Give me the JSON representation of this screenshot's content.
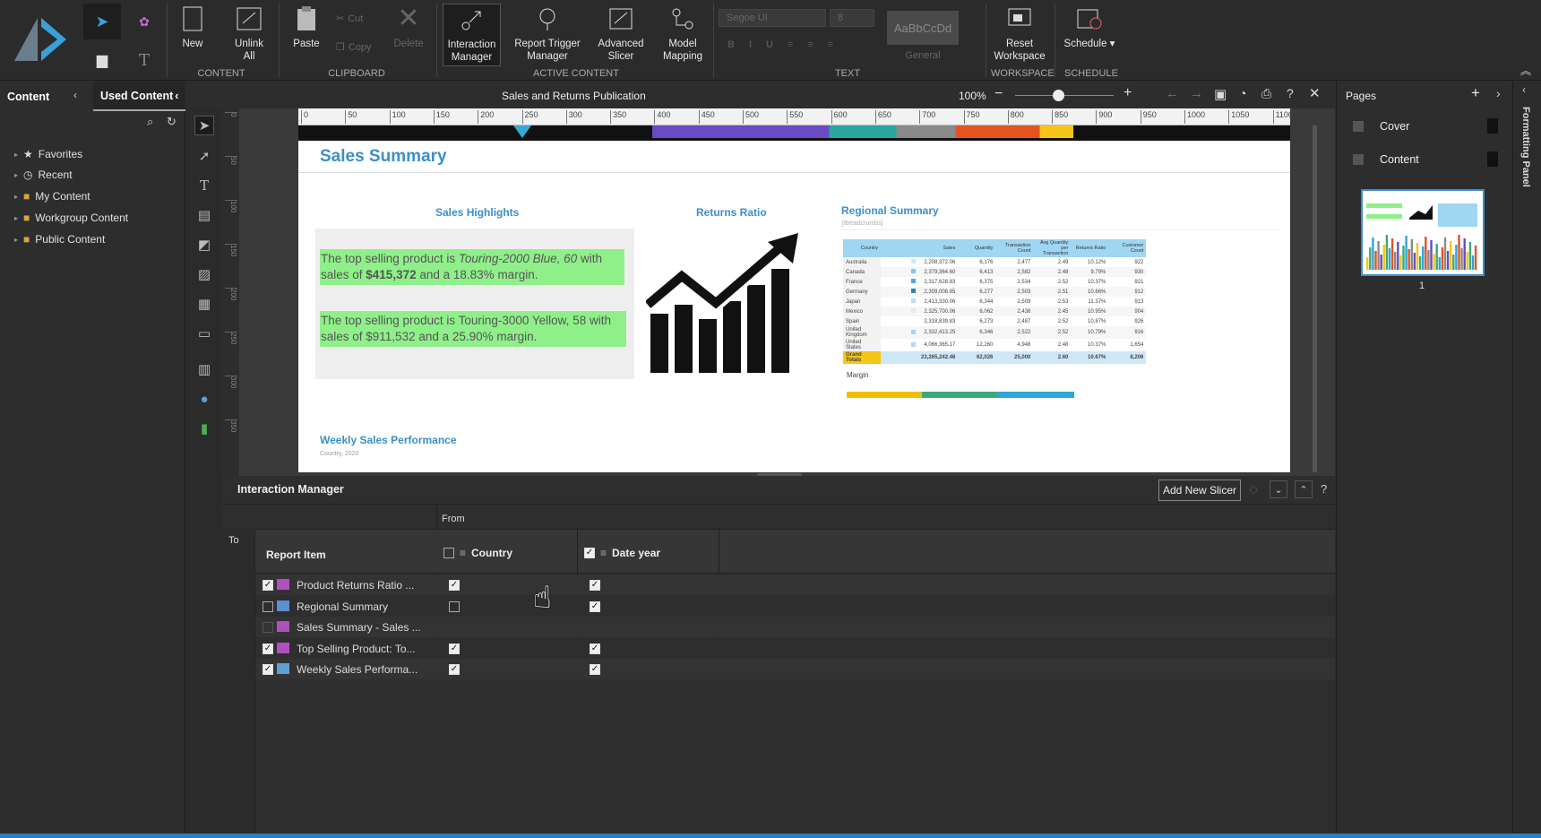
{
  "ribbon": {
    "new": "New",
    "unlink_all_1": "Unlink",
    "unlink_all_2": "All",
    "paste": "Paste",
    "cut": "Cut",
    "copy": "Copy",
    "delete": "Delete",
    "interaction_manager_1": "Interaction",
    "interaction_manager_2": "Manager",
    "report_trigger_1": "Report Trigger",
    "report_trigger_2": "Manager",
    "advanced_slicer_1": "Advanced",
    "advanced_slicer_2": "Slicer",
    "model_mapping_1": "Model",
    "model_mapping_2": "Mapping",
    "font_name": "Segoe UI",
    "font_size": "8",
    "style_preview": "AaBbCcDd",
    "style_name": "General",
    "reset_workspace_1": "Reset",
    "reset_workspace_2": "Workspace",
    "schedule": "Schedule ▾",
    "groups": {
      "content": "CONTENT",
      "clipboard": "CLIPBOARD",
      "active_content": "ACTIVE CONTENT",
      "text": "TEXT",
      "workspace": "WORKSPACE",
      "schedule": "SCHEDULE"
    }
  },
  "left_panel": {
    "tab_content": "Content",
    "tab_used": "Used Content",
    "tree": [
      "Favorites",
      "Recent",
      "My Content",
      "Workgroup Content",
      "Public Content"
    ]
  },
  "titlebar": {
    "title": "Sales and Returns Publication",
    "zoom": "100%"
  },
  "ruler_ticks": [
    "0",
    "50",
    "100",
    "150",
    "200",
    "250",
    "300",
    "350",
    "400",
    "450",
    "500",
    "550",
    "600",
    "650",
    "700",
    "750",
    "800",
    "850",
    "900",
    "950",
    "1000",
    "1050",
    "1100"
  ],
  "vruler_ticks": [
    "0",
    "50",
    "100",
    "150",
    "200",
    "250",
    "300",
    "350"
  ],
  "report": {
    "title": "Sales Summary",
    "highlights_title": "Sales Highlights",
    "highlight1_a": "The top selling product is ",
    "highlight1_b": "Touring-2000 Blue, 60",
    "highlight1_c": " with sales of ",
    "highlight1_d": "$415,372",
    "highlight1_e": " and a ",
    "highlight1_f": "18.83%",
    "highlight1_g": " margin.",
    "highlight2": "The top selling product is Touring-3000 Yellow, 58 with sales of $911,532 and a 25.90% margin.",
    "returns_title": "Returns Ratio",
    "regional_title": "Regional Summary",
    "regional_breadcrumb": "[Breadcrumbs]",
    "regional_headers": [
      "Country",
      "",
      "Sales",
      "Quantity",
      "Transaction Count",
      "Avg Quantity per Transaction",
      "Returns Ratio",
      "Customer Count"
    ],
    "regional_rows": [
      [
        "Australia",
        "2,208,372.06",
        "6,176",
        "2,477",
        "2.49",
        "10.12%",
        "922"
      ],
      [
        "Canada",
        "2,379,364.60",
        "6,413",
        "2,582",
        "2.48",
        "9.79%",
        "930"
      ],
      [
        "France",
        "2,317,628.83",
        "6,375",
        "2,534",
        "2.52",
        "10.37%",
        "921"
      ],
      [
        "Germany",
        "2,309,008.65",
        "6,277",
        "2,503",
        "2.51",
        "10.66%",
        "912"
      ],
      [
        "Japan",
        "2,413,330.06",
        "6,344",
        "2,509",
        "2.53",
        "11.37%",
        "913"
      ],
      [
        "Mexico",
        "2,325,700.06",
        "6,062",
        "2,438",
        "2.45",
        "10.95%",
        "904"
      ],
      [
        "Spain",
        "2,318,839.83",
        "6,273",
        "2,487",
        "2.52",
        "10.87%",
        "926"
      ],
      [
        "United Kingdom",
        "2,332,413.25",
        "6,346",
        "2,522",
        "2.52",
        "10.79%",
        "916"
      ],
      [
        "United States",
        "4,066,365.17",
        "12,260",
        "4,948",
        "2.48",
        "10.37%",
        "1,654"
      ]
    ],
    "regional_total": [
      "Grand Totals",
      "23,265,242.46",
      "62,026",
      "25,000",
      "2.60",
      "10.67%",
      "8,206"
    ],
    "margin_label": "Margin",
    "weekly_title": "Weekly Sales Performance",
    "weekly_sub": "Country, 2020"
  },
  "interaction_manager": {
    "title": "Interaction Manager",
    "add_slicer": "Add New Slicer",
    "from": "From",
    "to": "To",
    "report_item_header": "Report Item",
    "col_country": "Country",
    "col_date_year": "Date year",
    "rows": [
      {
        "label": "Product Returns Ratio ...",
        "enabled": true,
        "country": true,
        "date": true
      },
      {
        "label": "Regional Summary",
        "enabled": false,
        "country": false,
        "date": true
      },
      {
        "label": "Sales Summary - Sales ...",
        "enabled": null,
        "country": null,
        "date": null
      },
      {
        "label": "Top Selling Product: To...",
        "enabled": true,
        "country": true,
        "date": true
      },
      {
        "label": "Weekly Sales Performa...",
        "enabled": true,
        "country": true,
        "date": true
      }
    ]
  },
  "pages_panel": {
    "title": "Pages",
    "pages": [
      "Cover",
      "Content"
    ],
    "thumb_number": "1"
  },
  "formatting_panel": {
    "label": "Formatting Panel"
  },
  "colors": {
    "accent": "#3b8fc9",
    "highlight_green": "#8ff08a",
    "header_blue": "#9fd6f2"
  }
}
